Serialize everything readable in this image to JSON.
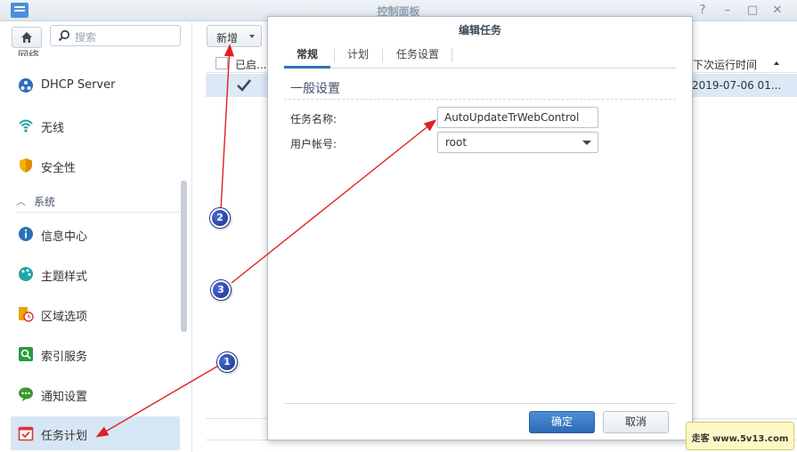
{
  "window": {
    "title": "控制面板"
  },
  "sidebar": {
    "search_placeholder": "搜索",
    "partial_item_label": "网络",
    "items": [
      {
        "label": "DHCP Server",
        "icon": "dhcp-server-icon"
      },
      {
        "label": "无线",
        "icon": "wifi-icon"
      },
      {
        "label": "安全性",
        "icon": "shield-icon"
      }
    ],
    "section": {
      "label": "系统"
    },
    "system_items": [
      {
        "label": "信息中心",
        "icon": "info-icon"
      },
      {
        "label": "主题样式",
        "icon": "palette-icon"
      },
      {
        "label": "区域选项",
        "icon": "regional-clock-icon"
      },
      {
        "label": "索引服务",
        "icon": "index-search-icon"
      },
      {
        "label": "通知设置",
        "icon": "chat-bubble-icon"
      },
      {
        "label": "任务计划",
        "icon": "calendar-check-icon",
        "active": true
      }
    ]
  },
  "content": {
    "new_button_label": "新增",
    "grid": {
      "col_enabled": "已启...",
      "col_next_run": "下次运行时间",
      "row": {
        "enabled": true,
        "next_run": "2019-07-06 01..."
      }
    }
  },
  "dialog": {
    "title": "编辑任务",
    "tabs": [
      "常规",
      "计划",
      "任务设置"
    ],
    "active_tab": 0,
    "group_title": "一般设置",
    "task_name_label": "任务名称:",
    "task_name_value": "AutoUpdateTrWebControl",
    "user_label": "用户帐号:",
    "user_value": "root",
    "ok_label": "确定",
    "cancel_label": "取消"
  },
  "annotations": {
    "markers": [
      "1",
      "2",
      "3"
    ],
    "arrow_color": "#e02020"
  },
  "watermark": {
    "text": "走客 www.5v13.com"
  },
  "colors": {
    "accent": "#2d73b8",
    "active_bg": "#d7e6f5",
    "marker": "#1a2c8c"
  }
}
